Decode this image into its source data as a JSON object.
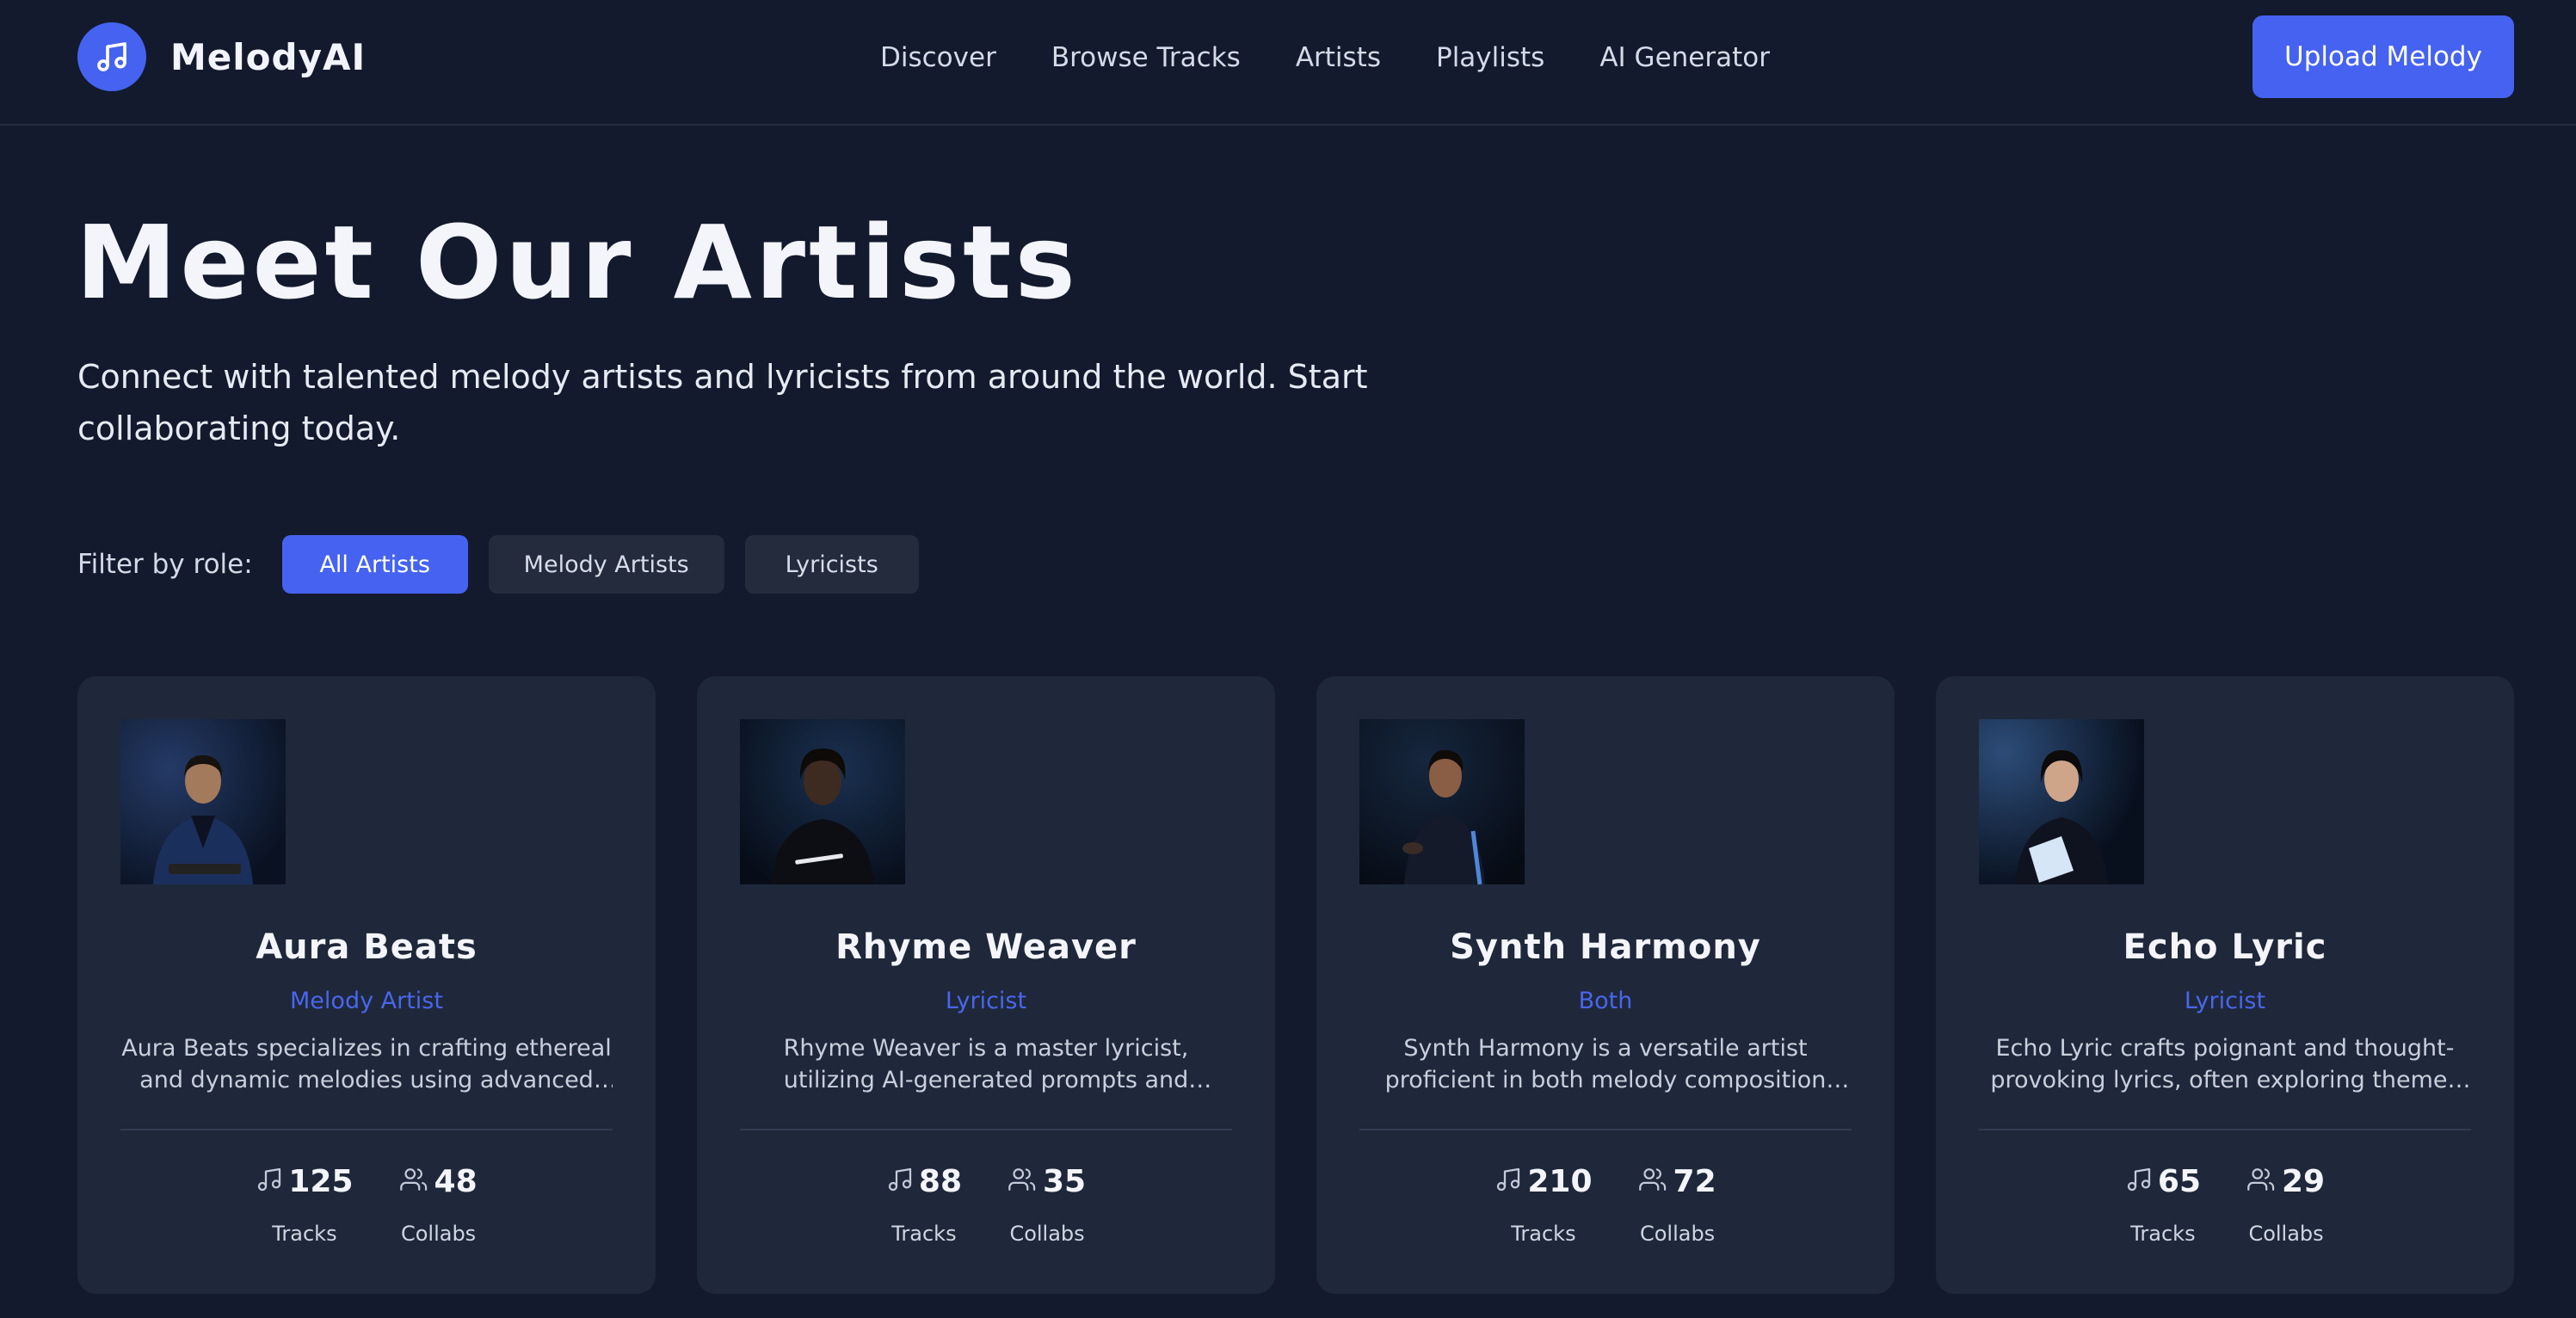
{
  "brand": {
    "name": "MelodyAI",
    "icon": "music-note-icon"
  },
  "nav": {
    "links": [
      "Discover",
      "Browse Tracks",
      "Artists",
      "Playlists",
      "AI Generator"
    ],
    "cta": "Upload Melody"
  },
  "hero": {
    "title": "Meet Our Artists",
    "subtitle": "Connect with talented melody artists and lyricists from around the world. Start collaborating today."
  },
  "filter": {
    "label": "Filter by role:",
    "options": [
      "All Artists",
      "Melody Artists",
      "Lyricists"
    ],
    "selected": "All Artists"
  },
  "colors": {
    "accent": "#4563f0",
    "background": "#131a2d",
    "card": "#1e283a"
  },
  "artists": [
    {
      "name": "Aura Beats",
      "role": "Melody Artist",
      "bio": "Aura Beats specializes in crafting ethereal and dynamic melodies using advanced AI...",
      "tracks": "125",
      "collabs": "48",
      "tracks_label": "Tracks",
      "collabs_label": "Collabs"
    },
    {
      "name": "Rhyme Weaver",
      "role": "Lyricist",
      "bio": "Rhyme Weaver is a master lyricist, utilizing AI-generated prompts and natural language...",
      "tracks": "88",
      "collabs": "35",
      "tracks_label": "Tracks",
      "collabs_label": "Collabs"
    },
    {
      "name": "Synth Harmony",
      "role": "Both",
      "bio": "Synth Harmony is a versatile artist proficient in both melody composition and lyric writin...",
      "tracks": "210",
      "collabs": "72",
      "tracks_label": "Tracks",
      "collabs_label": "Collabs"
    },
    {
      "name": "Echo Lyric",
      "role": "Lyricist",
      "bio": "Echo Lyric crafts poignant and thought-provoking lyrics, often exploring themes o...",
      "tracks": "65",
      "collabs": "29",
      "tracks_label": "Tracks",
      "collabs_label": "Collabs"
    }
  ]
}
